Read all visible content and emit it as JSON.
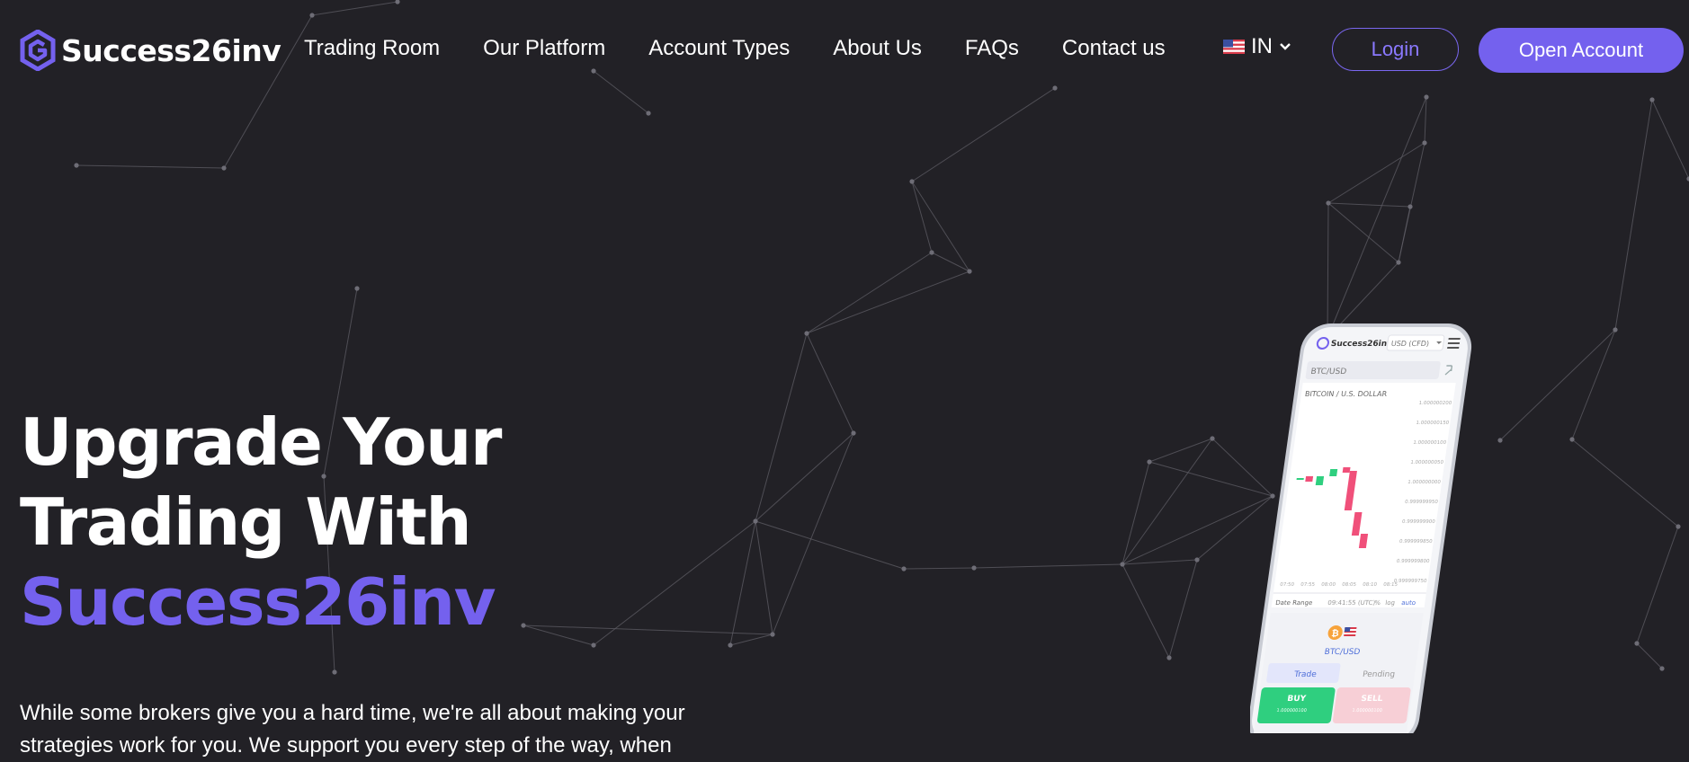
{
  "header": {
    "brand": "Success26inv",
    "nav": [
      {
        "label": "Trading Room"
      },
      {
        "label": "Our Platform"
      },
      {
        "label": "Account Types"
      },
      {
        "label": "About Us"
      },
      {
        "label": "FAQs"
      },
      {
        "label": "Contact us"
      }
    ],
    "language": "IN",
    "login_label": "Login",
    "open_account_label": "Open Account"
  },
  "hero": {
    "line1": "Upgrade Your",
    "line2": "Trading With",
    "line3": "Success26inv",
    "description": "While some brokers give you a hard time, we're all about making your strategies work for you. We support you every step of the way, when"
  },
  "phone": {
    "brand": "Success26inv",
    "currency": "USD (CFD)",
    "symbol": "BTC/USD",
    "instrument": "BITCOIN / U.S. DOLLAR",
    "price_ticks": [
      "1.000000200",
      "1.000000150",
      "1.000000100",
      "1.000000050",
      "1.000000000",
      "0.999999950",
      "0.999999900",
      "0.999999850",
      "0.999999800",
      "0.999999750"
    ],
    "time_ticks": [
      "07:50",
      "07:55",
      "08:00",
      "08:05",
      "08:10",
      "08:15"
    ],
    "date_range": "Date Range",
    "clock": "09:41:55 (UTC)",
    "scale_options": [
      "%",
      "log",
      "auto"
    ],
    "asset": "BTC/USD",
    "tab_trade": "Trade",
    "tab_pending": "Pending",
    "buy_label": "BUY",
    "buy_price": "1.000000100",
    "sell_label": "SELL",
    "sell_price": "1.000000100"
  },
  "colors": {
    "background": "#222126",
    "accent": "#7461ee",
    "bull": "#2fcf7f",
    "bear": "#f0507a"
  },
  "icons": {
    "logo": "hexagon-g-logo-icon",
    "flag": "us-flag-icon",
    "dropdown": "chevron-down-icon",
    "bitcoin": "bitcoin-icon",
    "menu": "hamburger-menu-icon",
    "expand": "expand-icon"
  }
}
